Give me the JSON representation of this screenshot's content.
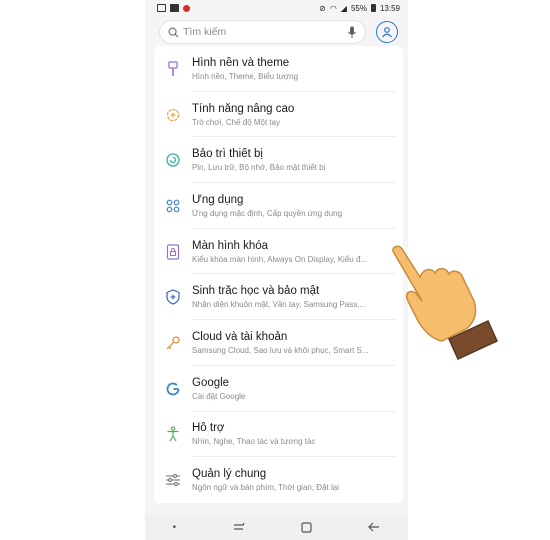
{
  "status": {
    "battery": "55%",
    "time": "13:59"
  },
  "search": {
    "placeholder": "Tìm kiếm"
  },
  "items": [
    {
      "title": "Hình nền và theme",
      "subtitle": "Hình nền, Theme, Biểu tượng",
      "icon": "brush-icon",
      "color": "#9b72c9"
    },
    {
      "title": "Tính năng nâng cao",
      "subtitle": "Trò chơi, Chế độ Một tay",
      "icon": "gear-plus-icon",
      "color": "#e8a33b"
    },
    {
      "title": "Bảo trì thiết bị",
      "subtitle": "Pin, Lưu trữ, Bộ nhớ, Bảo mật thiết bị",
      "icon": "refresh-circle-icon",
      "color": "#34b3a0"
    },
    {
      "title": "Ứng dụng",
      "subtitle": "Ứng dụng mặc định, Cấp quyền ứng dụng",
      "icon": "apps-grid-icon",
      "color": "#3a86c8"
    },
    {
      "title": "Màn hình khóa",
      "subtitle": "Kiểu khóa màn hình, Always On Display, Kiểu đ...",
      "icon": "lock-icon",
      "color": "#9b72c9"
    },
    {
      "title": "Sinh trắc học và bảo mật",
      "subtitle": "Nhận diện khuôn mặt, Vân tay, Samsung Pass,...",
      "icon": "shield-icon",
      "color": "#3a62c8"
    },
    {
      "title": "Cloud và tài khoản",
      "subtitle": "Samsung Cloud, Sao lưu và khôi phục, Smart S...",
      "icon": "key-icon",
      "color": "#e8913b"
    },
    {
      "title": "Google",
      "subtitle": "Cài đặt Google",
      "icon": "google-icon",
      "color": "#3a86c8"
    },
    {
      "title": "Hỗ trợ",
      "subtitle": "Nhìn, Nghe, Thao tác và tương tác",
      "icon": "accessibility-icon",
      "color": "#4caf50"
    },
    {
      "title": "Quản lý chung",
      "subtitle": "Ngôn ngữ và bàn phím, Thời gian, Đặt lại",
      "icon": "sliders-icon",
      "color": "#777777"
    }
  ]
}
